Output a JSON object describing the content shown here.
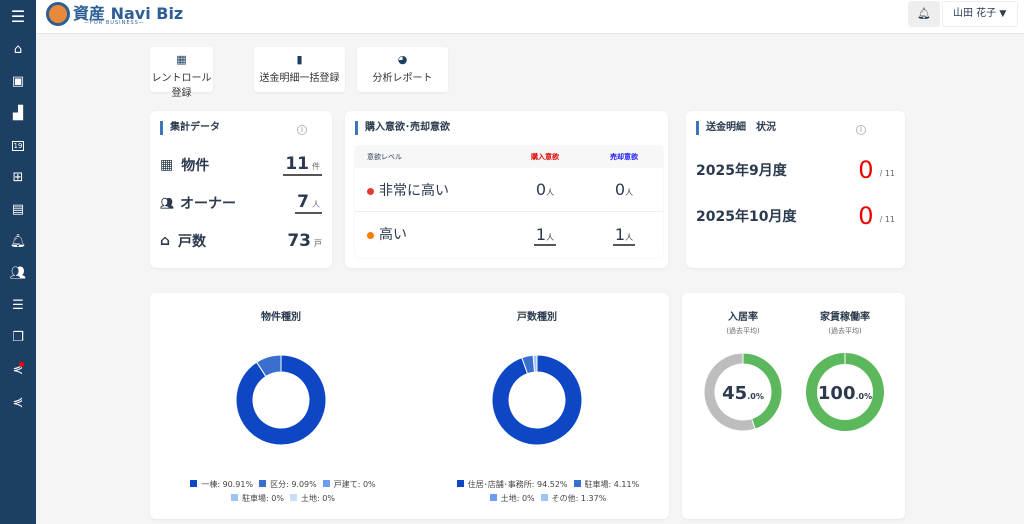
{
  "header": {
    "logo_text": "資産 Navi Biz",
    "logo_sub": "—FOR BUSINESS—",
    "user_name": "山田 花子"
  },
  "sidebar": {
    "icons": [
      "menu-icon",
      "home-icon",
      "contact-icon",
      "building-icon",
      "calendar-icon",
      "clipboard-add-icon",
      "clipboard-icon",
      "bell-icon",
      "users-icon",
      "message-icon",
      "copy-icon",
      "share-alert-icon",
      "share-icon"
    ],
    "calendar_day": "19"
  },
  "actions": [
    {
      "label": "レントロール登録",
      "icon": "spreadsheet-icon"
    },
    {
      "label": "送金明細一括登録",
      "icon": "file-add-icon"
    },
    {
      "label": "分析レポート",
      "icon": "pie-chart-icon"
    }
  ],
  "summary": {
    "title": "集計データ",
    "rows": [
      {
        "label": "物件",
        "value": "11",
        "unit": "件",
        "icon": "building-icon"
      },
      {
        "label": "オーナー",
        "value": "7",
        "unit": "人",
        "icon": "users-icon"
      },
      {
        "label": "戸数",
        "value": "73",
        "unit": "戸",
        "icon": "home-icon"
      }
    ]
  },
  "intent": {
    "title": "購入意欲･売却意欲",
    "headers": [
      "意欲レベル",
      "購入意欲",
      "売却意欲"
    ],
    "rows": [
      {
        "level": "非常に高い",
        "buy": "0",
        "sell": "0",
        "unit": "人",
        "color": "#e53935"
      },
      {
        "level": "高い",
        "buy": "1",
        "sell": "1",
        "unit": "人",
        "color": "#f57c00"
      }
    ],
    "buy_color": "#e00000",
    "sell_color": "#1a1aff"
  },
  "remit": {
    "title": "送金明細　状況",
    "rows": [
      {
        "period": "2025年9月度",
        "count": "0",
        "total": "/ 11"
      },
      {
        "period": "2025年10月度",
        "count": "0",
        "total": "/ 11"
      }
    ]
  },
  "chart_data": [
    {
      "type": "pie",
      "title": "物件種別",
      "categories": [
        "一棟",
        "区分",
        "戸建て",
        "駐車場",
        "土地"
      ],
      "values": [
        90.91,
        9.09,
        0,
        0,
        0
      ],
      "legend": [
        "一棟: 90.91%",
        "区分: 9.09%",
        "戸建て: 0%",
        "駐車場: 0%",
        "土地: 0%"
      ],
      "colors": [
        "#0d47c4",
        "#3a6fd0",
        "#6f9cf0",
        "#9fc3f5",
        "#c9defa"
      ]
    },
    {
      "type": "pie",
      "title": "戸数種別",
      "categories": [
        "住居･店舗･事務所",
        "駐車場",
        "土地",
        "その他"
      ],
      "values": [
        94.52,
        4.11,
        0,
        1.37
      ],
      "legend": [
        "住居･店舗･事務所: 94.52%",
        "駐車場: 4.11%",
        "土地: 0%",
        "その他: 1.37%"
      ],
      "colors": [
        "#0d47c4",
        "#3a6fd0",
        "#6f9cf0",
        "#9fc3f5"
      ]
    },
    {
      "type": "pie",
      "title": "入居率",
      "subtitle": "(過去平均)",
      "value": 45.0,
      "int": "45",
      "dec": ".0%",
      "colors": [
        "#5cb85c",
        "#bdbdbd"
      ]
    },
    {
      "type": "pie",
      "title": "家賃稼働率",
      "subtitle": "(過去平均)",
      "value": 100.0,
      "int": "100",
      "dec": ".0%",
      "colors": [
        "#5cb85c",
        "#bdbdbd"
      ]
    }
  ]
}
